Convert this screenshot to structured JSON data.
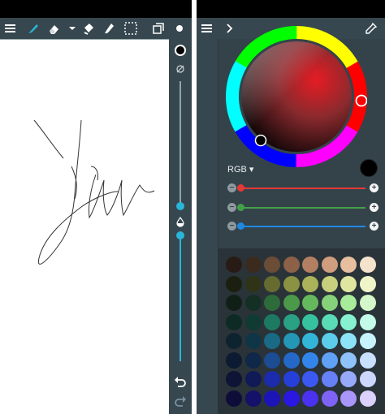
{
  "left": {
    "toolbar": {
      "icons": [
        "menu-icon",
        "brush-icon",
        "eraser-icon",
        "chevron-down-icon",
        "fill-icon",
        "smudge-icon",
        "selection-icon",
        "layers-icon",
        "brush-dot-icon"
      ]
    },
    "side": {
      "top_color": "#000000",
      "slider1_level": 0.52,
      "slider2_level": 0.45
    }
  },
  "right": {
    "picker": {
      "mode_label": "RGB",
      "current_color": "#000000"
    },
    "sliders": [
      {
        "name": "red",
        "color": "#e53935"
      },
      {
        "name": "green",
        "color": "#43a047"
      },
      {
        "name": "blue",
        "color": "#1e88e5"
      }
    ],
    "palette": [
      [
        "#281b15",
        "#3b2a1e",
        "#6b4c36",
        "#8c6147",
        "#b27f62",
        "#cf9e7f",
        "#e7be9f",
        "#f5e2cc"
      ],
      [
        "#1b1f10",
        "#2f3417",
        "#666b2f",
        "#8b9343",
        "#aab35a",
        "#c8d07d",
        "#e0e6a0",
        "#f0f5c9"
      ],
      [
        "#102017",
        "#143024",
        "#2d6b3a",
        "#4b9a4a",
        "#66b85e",
        "#86d27a",
        "#a8eb9b",
        "#d4f8c9"
      ],
      [
        "#0e2a25",
        "#0f3b33",
        "#1d7a62",
        "#2aa184",
        "#36c29e",
        "#59dbb6",
        "#86f0d1",
        "#c4fae8"
      ],
      [
        "#0d2430",
        "#0f3646",
        "#1a6a86",
        "#2496b6",
        "#33b5d7",
        "#5bcde9",
        "#8ce2f6",
        "#c7f3fc"
      ],
      [
        "#0c1b32",
        "#0f2749",
        "#1c4c92",
        "#2468c8",
        "#3385ea",
        "#5fa2f5",
        "#8fc1fb",
        "#c9e0fe"
      ],
      [
        "#0d1436",
        "#101a56",
        "#1b2bab",
        "#263fd8",
        "#3b58f2",
        "#6680f7",
        "#97aafa",
        "#cdd6fd"
      ],
      [
        "#0e0d3a",
        "#13116a",
        "#1d14b8",
        "#2a17e0",
        "#4b31f0",
        "#7f63f6",
        "#aa96fa",
        "#dcd1fd"
      ]
    ]
  }
}
